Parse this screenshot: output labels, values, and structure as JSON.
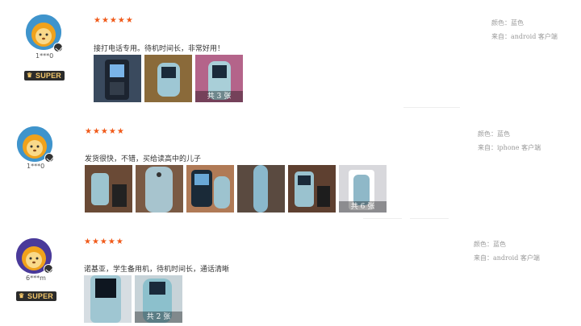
{
  "reviews": [
    {
      "username": "1***0",
      "badge": "SUPER",
      "rating_stars": "★★★★★",
      "rating": 5,
      "content": "接打电话专用。待机时间长，非常好用！",
      "image_count_label": "共 3 张",
      "color_label": "颜色：蓝色",
      "source_label": "来自：android 客户端"
    },
    {
      "username": "1***0",
      "rating_stars": "★★★★★",
      "rating": 5,
      "content": "发货很快，不错，买给读高中的儿子",
      "image_count_label": "共 6 张",
      "color_label": "颜色：蓝色",
      "source_label": "来自：iphone 客户端"
    },
    {
      "username": "6***m",
      "badge": "SUPER",
      "rating_stars": "★★★★★",
      "rating": 5,
      "content": "诺基亚，学生备用机，待机时间长，通话清晰",
      "image_count_label": "共 2 张",
      "color_label": "颜色：蓝色",
      "source_label": "来自：android 客户端"
    }
  ],
  "colors": {
    "star": "#f05a1a",
    "badge_bg": "#2b2b2b",
    "badge_text": "#f2c66a",
    "phone_blue": "#8fb8c8"
  }
}
